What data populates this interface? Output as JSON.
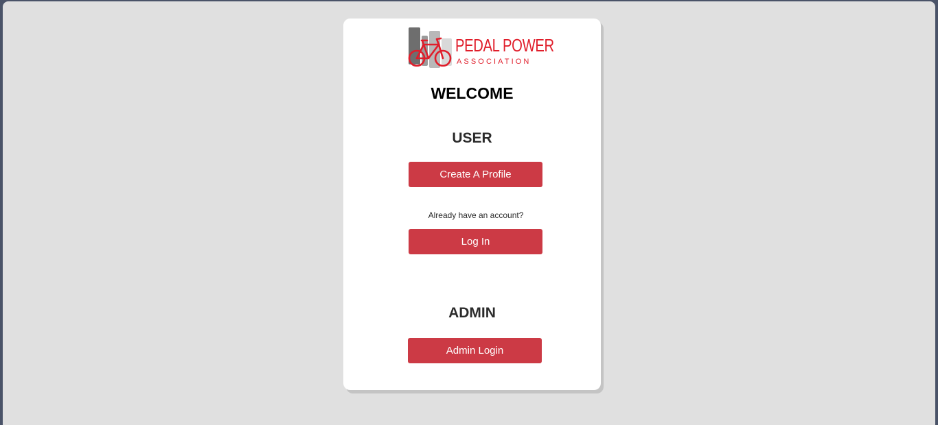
{
  "logo": {
    "title": "PEDAL POWER",
    "subtitle": "ASSOCIATION",
    "icon": "bicycle-icon",
    "accent_color": "#e01e2b"
  },
  "welcome": "WELCOME",
  "user_section": {
    "heading": "USER",
    "create_label": "Create A Profile",
    "account_prompt": "Already have an account?",
    "login_label": "Log In"
  },
  "admin_section": {
    "heading": "ADMIN",
    "login_label": "Admin Login"
  },
  "colors": {
    "button": "#cc3a45",
    "background": "#e0e0e0",
    "card": "#ffffff"
  }
}
